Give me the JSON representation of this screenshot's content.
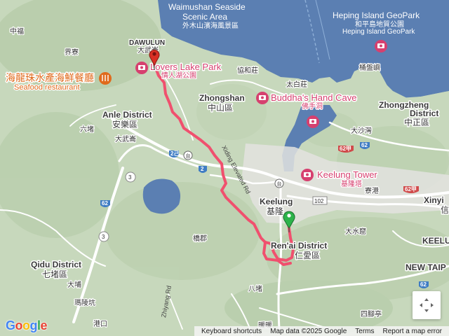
{
  "map": {
    "labels": {
      "wanli_seaside_en_1": "Waimushan Seaside",
      "wanli_seaside_en_2": "Scenic Area",
      "wanli_seaside_zh": "外木山濱海風景區",
      "heping_en": "Heping Island GeoPark",
      "heping_zh": "和平島地質公園",
      "heping_en2": "Heping Island GeoPark",
      "zhongfu": "中福",
      "jieliao": "界寮",
      "dawulun": "DAWULUN",
      "dawulun_zh": "大武崙",
      "lovers_lake_en": "Lovers Lake Park",
      "lovers_lake_zh": "情人湖公園",
      "seafood_zh": "海龍珠水產海鮮餐廳",
      "seafood_en": "Seafood restaurant",
      "xiehezhuang": "協和莊",
      "taibaizhuang": "太白莊",
      "zhongshan_en": "Zhongshan",
      "zhongshan_zh": "中山區",
      "buddha_en": "Buddha's Hand Cave",
      "buddha_zh": "佛手洞",
      "tongliao": "桶盤嶼",
      "zhongzheng_en_1": "Zhongzheng",
      "zhongzheng_en_2": "District",
      "zhongzheng_zh": "中正區",
      "anle_en": "Anle District",
      "anle_zh": "安樂區",
      "liuzhou": "六堵",
      "dawushan": "大武崙",
      "dashawan": "大沙灣",
      "xiding": "Xiding Elevated Rd",
      "keelung_tower_en": "Keelung Tower",
      "keelung_tower_zh": "基隆塔",
      "keelung_en": "Keelung",
      "keelung_zh": "基隆",
      "liaogang": "寮港",
      "xinyi": "Xinyi",
      "xinyi_zh": "信",
      "renai_en": "Ren'ai District",
      "renai_zh": "仁愛區",
      "qiaodu": "橋郡",
      "dashuiku": "大水窟",
      "keelung_right": "KEELU",
      "qidu_en": "Qidu District",
      "qidu_zh": "七堵區",
      "dapu": "大埔",
      "new_taipei": "NEW TAIP",
      "badu": "八堵",
      "malingkeng": "瑪陵坑",
      "zhiyang": "Zhiyang Rd",
      "sijiaoting": "四腳亭",
      "ganggou": "港口",
      "nuanuan": "暖暖"
    },
    "roads": {
      "r2": "2",
      "r2c": "2己",
      "r62": "62",
      "r62a": "62甲",
      "r102": "102",
      "r3": "3",
      "r62_left": "62",
      "r62_bottom": "62"
    },
    "route": {
      "color": "#f0506e",
      "start_marker_color": "#2db34a",
      "end_marker_color": "#d93025"
    }
  },
  "attribution": {
    "shortcuts": "Keyboard shortcuts",
    "data": "Map data ©2025 Google",
    "terms": "Terms",
    "report": "Report a map error"
  },
  "logo": {
    "text": "Google"
  },
  "controls": {
    "recenter_icon": "crosshair-icon"
  }
}
